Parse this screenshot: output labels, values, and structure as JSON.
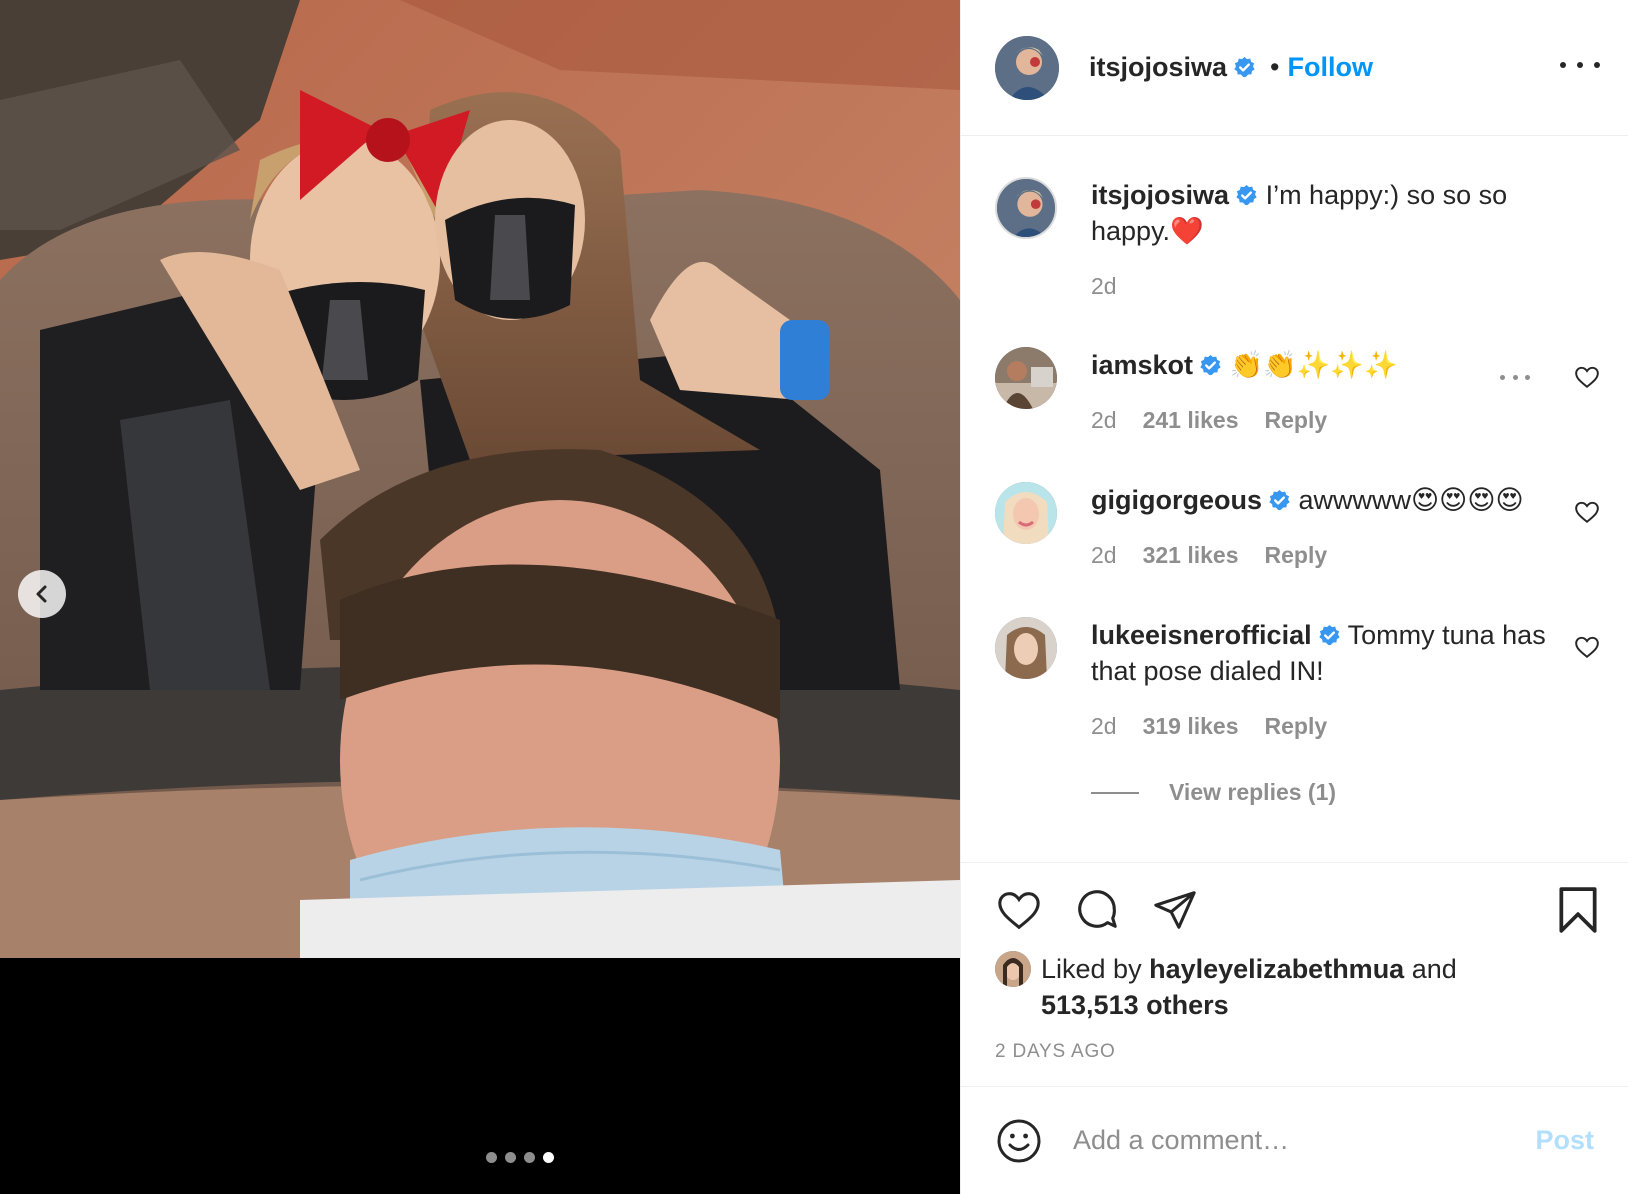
{
  "post": {
    "author": {
      "username": "itsjojosiwa",
      "verified": true,
      "follow_label": "Follow",
      "bullet": "•"
    },
    "caption": {
      "username": "itsjojosiwa",
      "text": "I’m happy:) so so so happy.❤️",
      "age": "2d"
    },
    "comments": [
      {
        "username": "iamskot",
        "text": "👏👏✨✨✨",
        "age": "2d",
        "likes": "241 likes",
        "reply_label": "Reply"
      },
      {
        "username": "gigigorgeous",
        "text": "awwwww😍😍😍😍",
        "age": "2d",
        "likes": "321 likes",
        "reply_label": "Reply"
      },
      {
        "username": "lukeeisnerofficial",
        "text": "Tommy tuna has that pose dialed IN!",
        "age": "2d",
        "likes": "319 likes",
        "reply_label": "Reply",
        "view_replies": "View replies (1)"
      }
    ],
    "liked_by": {
      "prefix": "Liked by",
      "user": "hayleyelizabethmua",
      "connector": "and",
      "others": "513,513 others"
    },
    "timestamp": "2 DAYS AGO",
    "comment_box": {
      "placeholder": "Add a comment…",
      "post_label": "Post"
    },
    "carousel": {
      "total": 4,
      "active_index": 3
    },
    "colors": {
      "accent": "#0095f6",
      "verified": "#3897f0",
      "muted": "#8e8e8e",
      "text": "#262626",
      "post_disabled": "#b2dffc"
    }
  }
}
